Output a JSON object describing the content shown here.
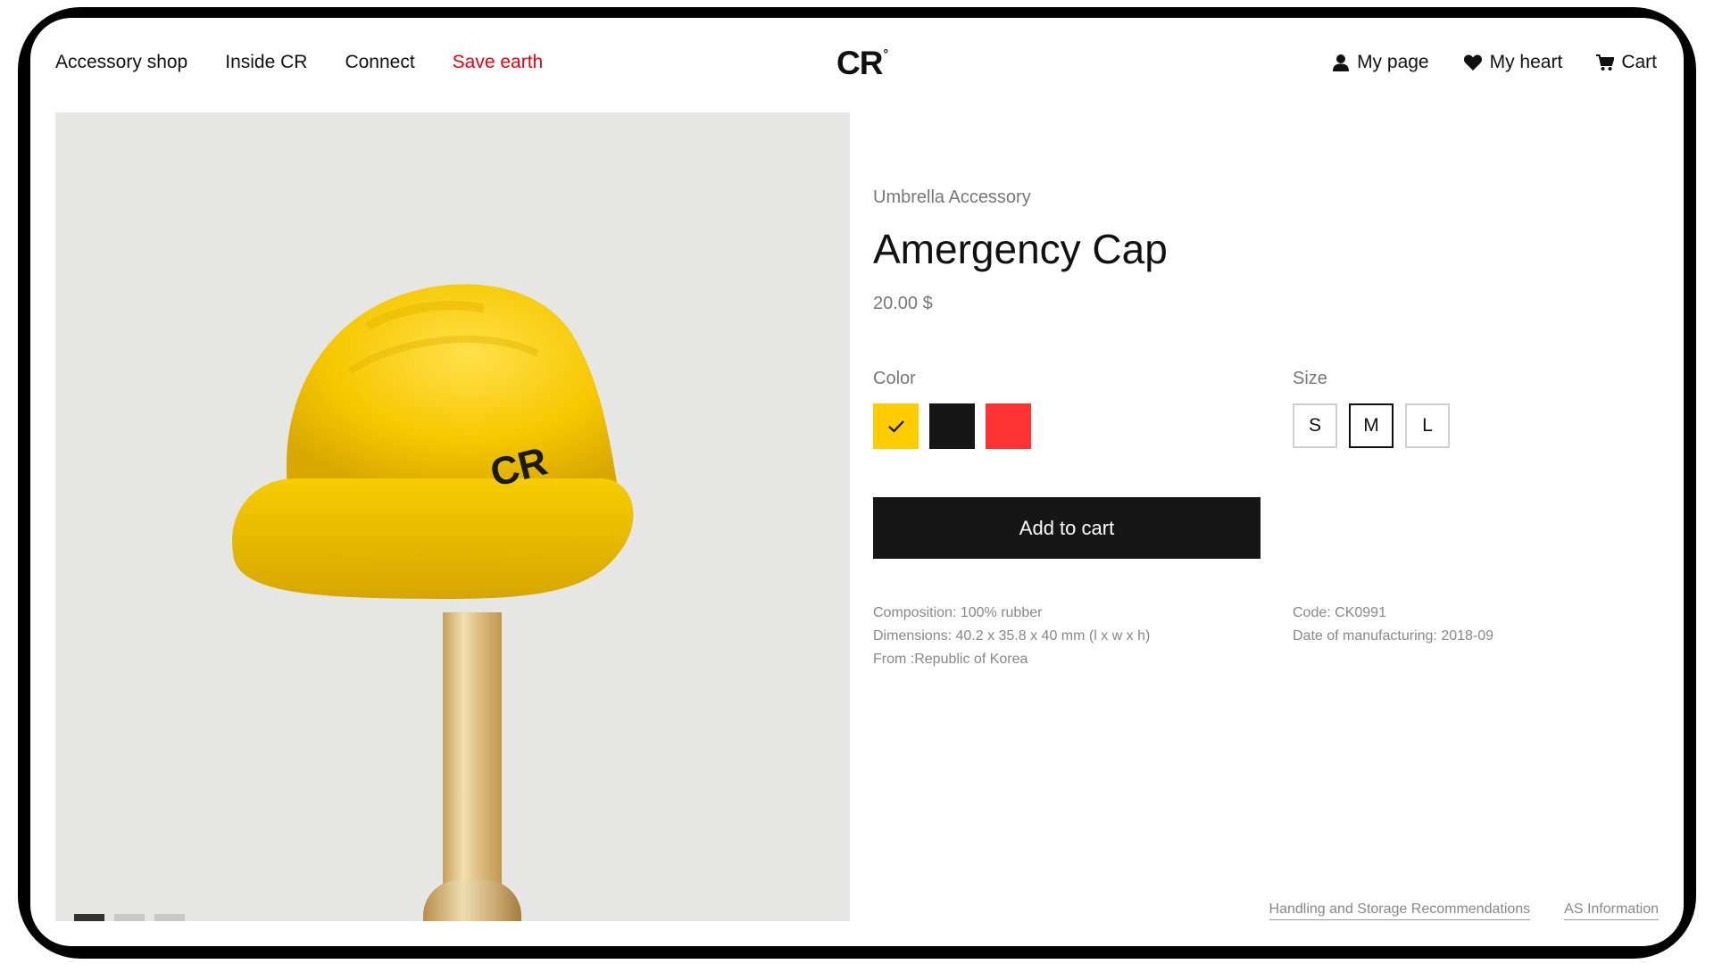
{
  "nav": {
    "left": [
      {
        "label": "Accessory shop"
      },
      {
        "label": "Inside CR"
      },
      {
        "label": "Connect"
      },
      {
        "label": "Save earth",
        "color": "#e60012"
      }
    ],
    "logo": {
      "text": "CR",
      "mark": "°"
    },
    "right": [
      {
        "label": "My page",
        "icon": "user-icon"
      },
      {
        "label": "My heart",
        "icon": "heart-icon"
      },
      {
        "label": "Cart",
        "icon": "cart-icon"
      }
    ]
  },
  "gallery": {
    "image": "yellow-hard-hat-umbrella-cap",
    "helmet_logo": "CR",
    "slides": 3,
    "active_slide": 1
  },
  "product": {
    "category": "Umbrella Accessory",
    "title": "Amergency Cap",
    "price": "20.00 $",
    "color_label": "Color",
    "colors": [
      {
        "name": "yellow",
        "hex": "#ffcc00",
        "selected": true
      },
      {
        "name": "black",
        "hex": "#161616",
        "selected": false
      },
      {
        "name": "red",
        "hex": "#ff3333",
        "selected": false
      }
    ],
    "size_label": "Size",
    "sizes": [
      {
        "label": "S",
        "selected": false
      },
      {
        "label": "M",
        "selected": true
      },
      {
        "label": "L",
        "selected": false
      }
    ],
    "add_to_cart": "Add to cart",
    "specs_left": [
      "Composition: 100% rubber",
      "Dimensions: 40.2 x 35.8 x 40 mm (l x w x h)",
      "From :Republic of Korea"
    ],
    "specs_right": [
      "Code: CK0991",
      "Date of manufacturing: 2018-09"
    ]
  },
  "footer": {
    "links": [
      "Handling and Storage Recommendations",
      "AS Information"
    ]
  }
}
